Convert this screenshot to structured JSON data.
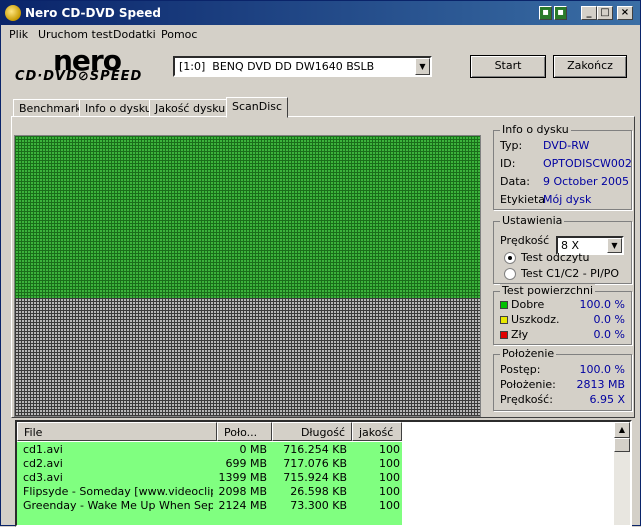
{
  "window": {
    "title": "Nero CD-DVD Speed"
  },
  "menu": [
    "Plik",
    "Uruchom test",
    "Dodatki",
    "Pomoc"
  ],
  "logo": {
    "nero": "nero",
    "sub": "CD·DVD⊘SPEED"
  },
  "drive": {
    "value": "[1:0]  BENQ DVD DD DW1640 BSLB"
  },
  "buttons": {
    "start": "Start",
    "quit": "Zakończ"
  },
  "tabs": [
    "Benchmark",
    "Info o dysku",
    "Jakość dysku",
    "ScanDisc"
  ],
  "disc_info": {
    "legend": "Info o dysku",
    "rows": [
      {
        "k": "Typ:",
        "v": "DVD-RW"
      },
      {
        "k": "ID:",
        "v": "OPTODISCW002"
      },
      {
        "k": "Data:",
        "v": "9 October 2005"
      },
      {
        "k": "Etykieta",
        "v": "Mój dysk"
      }
    ]
  },
  "settings": {
    "legend": "Ustawienia",
    "speed_label": "Prędkość",
    "speed_value": "8 X",
    "read_test": "Test odczytu",
    "c1c2_test": "Test C1/C2 - PI/PO"
  },
  "surface": {
    "legend": "Test powierzchni",
    "rows": [
      {
        "k": "Dobre",
        "v": "100.0 %",
        "color": "#00c000"
      },
      {
        "k": "Uszkodz.",
        "v": "0.0 %",
        "color": "#e8e800"
      },
      {
        "k": "Zły",
        "v": "0.0 %",
        "color": "#e00000"
      }
    ]
  },
  "position": {
    "legend": "Położenie",
    "rows": [
      {
        "k": "Postęp:",
        "v": "100.0 %"
      },
      {
        "k": "Położenie:",
        "v": "2813 MB"
      },
      {
        "k": "Prędkość:",
        "v": "6.95 X"
      }
    ]
  },
  "scan": {
    "good_fraction": 0.58
  },
  "list": {
    "headers": [
      "File",
      "Poło...",
      "Długość",
      "jakość"
    ],
    "rows": [
      [
        "cd1.avi",
        "0 MB",
        "716.254 KB",
        "100"
      ],
      [
        "cd2.avi",
        "699 MB",
        "717.076 KB",
        "100"
      ],
      [
        "cd3.avi",
        "1399 MB",
        "715.924 KB",
        "100"
      ],
      [
        "Flipsyde - Someday [www.videoclips.pl...",
        "2098 MB",
        "26.598 KB",
        "100"
      ],
      [
        "Greenday - Wake Me Up When Septe...",
        "2124 MB",
        "73.300 KB",
        "100"
      ]
    ]
  }
}
